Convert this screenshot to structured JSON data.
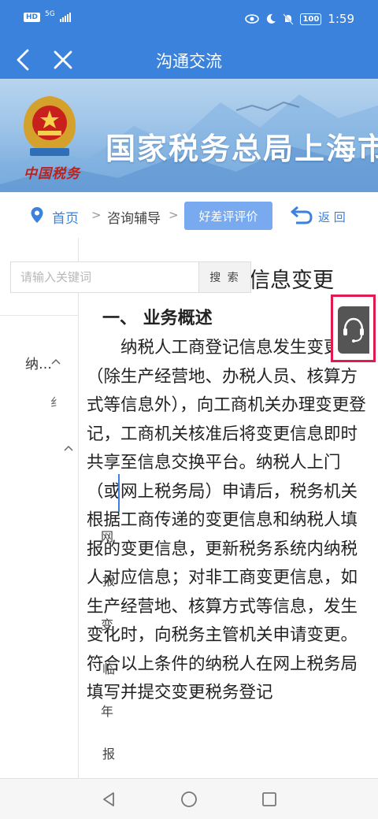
{
  "status_bar": {
    "hd": "HD",
    "network": "5G",
    "battery": "100",
    "time": "1:59"
  },
  "nav": {
    "title": "沟通交流"
  },
  "banner": {
    "title": "国家税务总局上海市",
    "slogan": "中国税务"
  },
  "breadcrumb": {
    "home": "首页",
    "separator": ">",
    "current": "咨询辅导",
    "rate_button": "好差评评价",
    "return_label": "返 回"
  },
  "search": {
    "placeholder": "请输入关键词",
    "button": "搜 索"
  },
  "sidebar": {
    "item1": "纳…",
    "item2": "纟"
  },
  "tree_chars": [
    "网",
    "报",
    "变",
    "临",
    "年",
    "报"
  ],
  "article": {
    "title": "信息变更",
    "section_heading": "一、 业务概述",
    "para1": "纳税人工商登记信息发生变更（除生产经营地、办税人员、核算方式等信息外），向工商机关办理变更登记，工商机关核准后将变更信息即时共享至信息交换平台。纳税人上门（或网上税务局）申请后，税务机关根据工商传递的变更信息和纳税人填报的变更信息，更新税务系统内纳税人对应信息；对非工商变更信息，如生产经营地、核算方式等信息，发生变化时，向税务主管机关申请变更。",
    "para2": "符合以上条件的纳税人在网上税务局填写并提交变更税务登记"
  },
  "colors": {
    "primary": "#3a82dc",
    "highlight": "#e01b4f",
    "rate_button": "#79aaf0"
  },
  "icons": [
    "back-arrow-icon",
    "close-icon",
    "location-pin-icon",
    "return-icon",
    "headset-icon",
    "chevron-up-icon"
  ]
}
